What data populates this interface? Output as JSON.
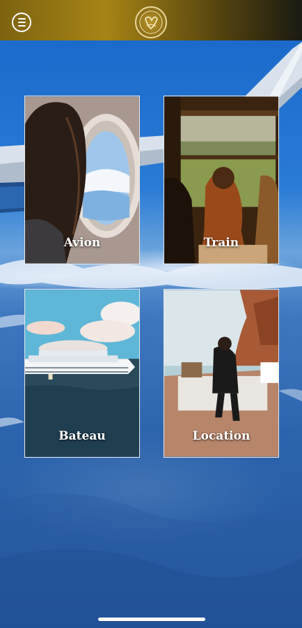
{
  "header": {
    "menu_icon": "hamburger-menu-icon",
    "logo_icon": "brand-logo-emblem",
    "gradient_colors": [
      "#7d6310",
      "#a78416",
      "#1a1a12"
    ]
  },
  "background": {
    "description_icon": "airplane-wing-over-clouds"
  },
  "cards": [
    {
      "id": "avion",
      "label": "Avion"
    },
    {
      "id": "train",
      "label": "Train"
    },
    {
      "id": "bateau",
      "label": "Bateau"
    },
    {
      "id": "location",
      "label": "Location"
    }
  ],
  "colors": {
    "label_text": "#ffffff",
    "card_border": "#e8e8e8"
  }
}
